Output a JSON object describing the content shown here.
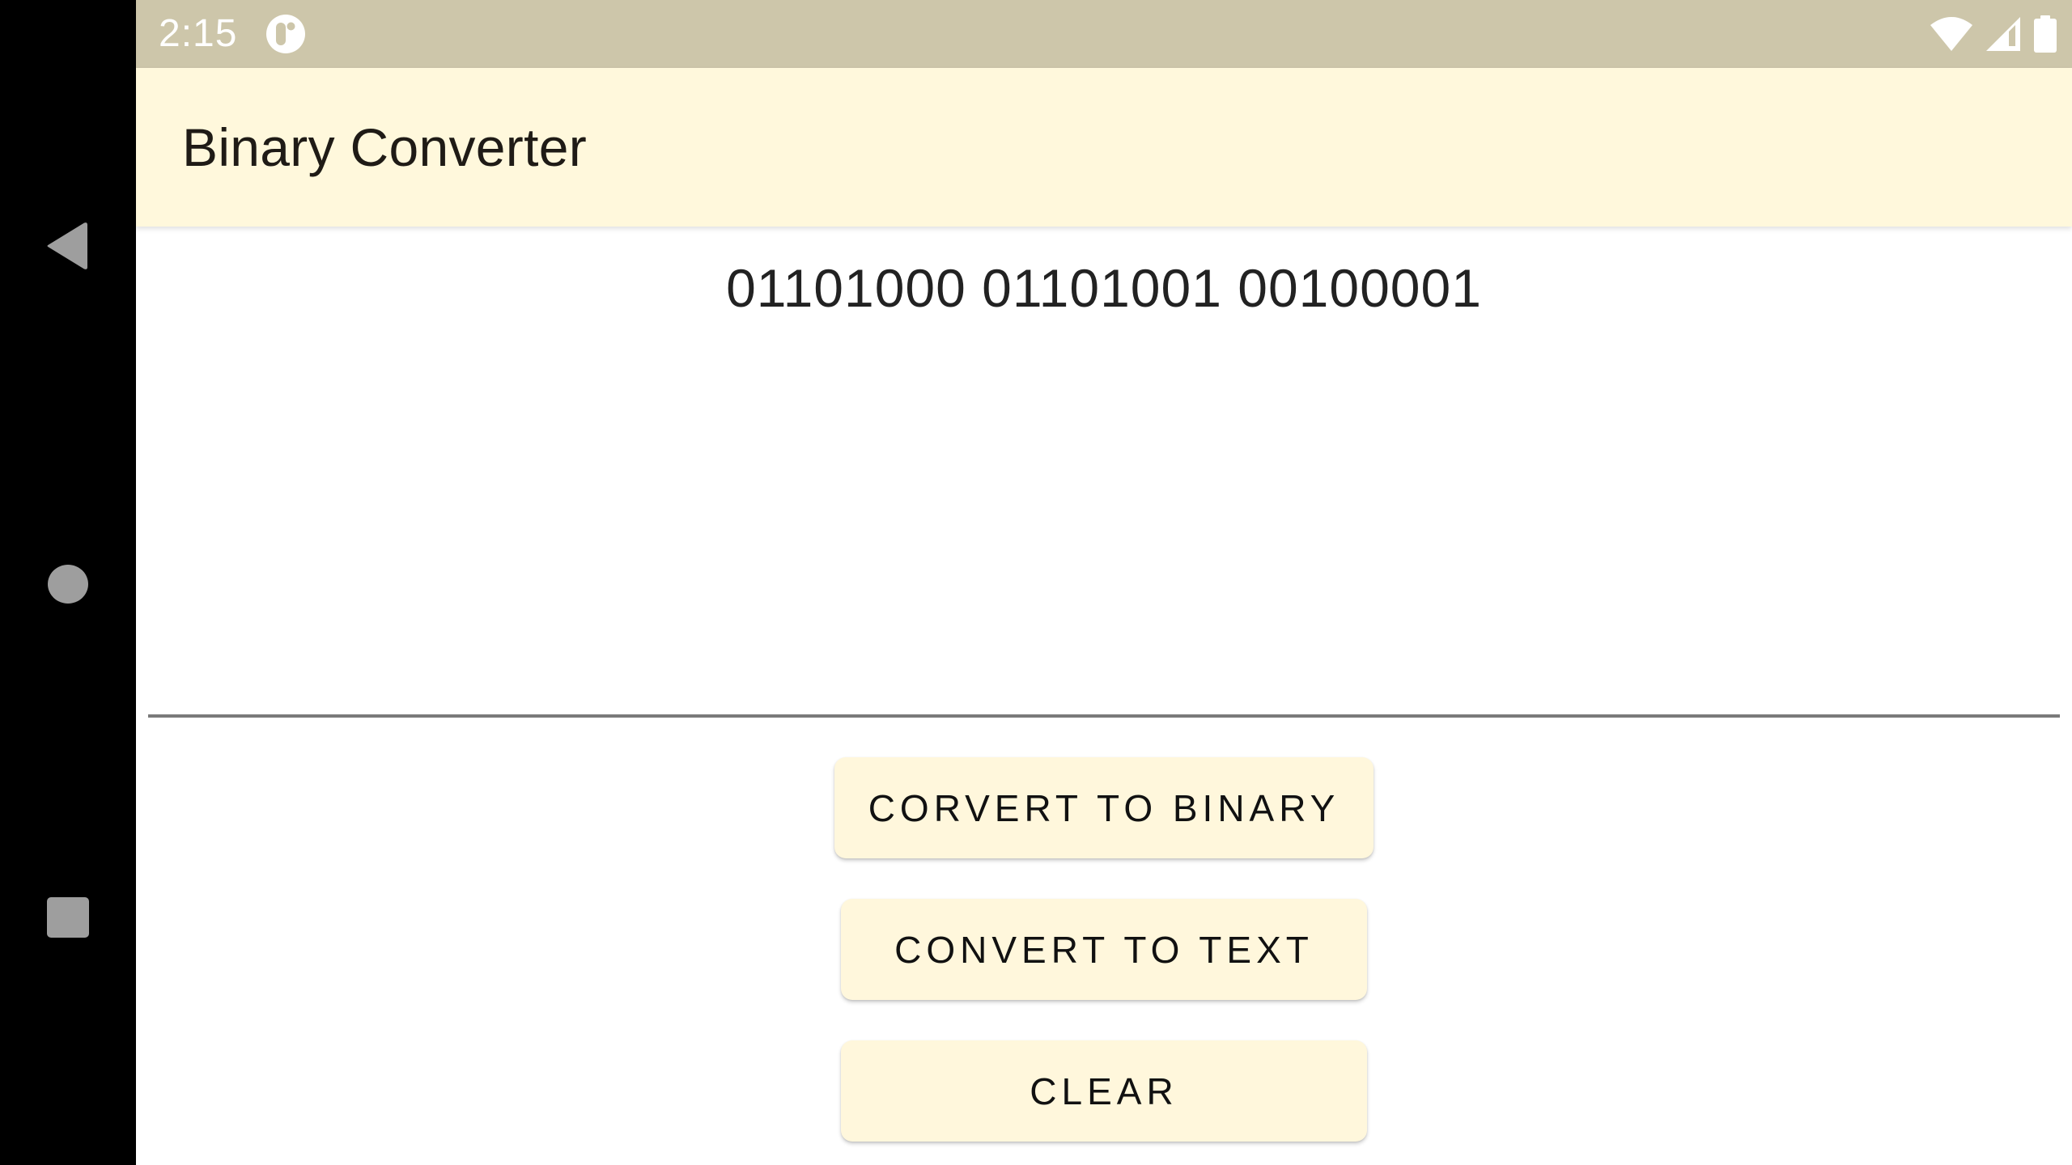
{
  "status_bar": {
    "time": "2:15",
    "icons": [
      "app-notification-icon",
      "wifi-icon",
      "cellular-signal-icon",
      "battery-icon"
    ],
    "background_color": "#cdc6aa"
  },
  "navigation_bar": {
    "buttons": [
      "back",
      "home",
      "recents"
    ]
  },
  "app_bar": {
    "title": "Binary Converter",
    "background_color": "#fff8dc"
  },
  "main": {
    "output_text": "01101000 01101001 00100001",
    "input": {
      "value": "",
      "placeholder": ""
    }
  },
  "buttons": {
    "convert_to_binary": "CORVERT TO BINARY",
    "convert_to_text": "CONVERT TO TEXT",
    "clear": "CLEAR",
    "background_color": "#fff7dc"
  }
}
